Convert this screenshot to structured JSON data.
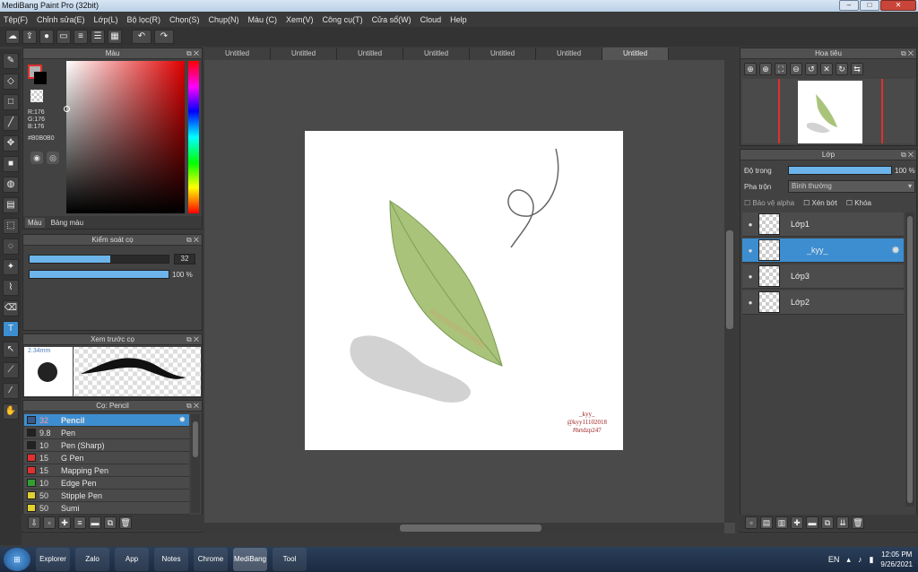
{
  "window": {
    "title": "MediBang Paint Pro (32bit)",
    "minimize": "–",
    "maximize": "□",
    "close": "✕"
  },
  "menu": [
    "Tệp(F)",
    "Chỉnh sửa(E)",
    "Lớp(L)",
    "Bộ lọc(R)",
    "Chọn(S)",
    "Chụp(N)",
    "Màu (C)",
    "Xem(V)",
    "Công cụ(T)",
    "Cửa sổ(W)",
    "Cloud",
    "Help"
  ],
  "toolbar_icons": [
    "cloud-icon",
    "upload-icon",
    "chat-icon",
    "comment-icon",
    "doc-icon",
    "list-icon",
    "grid-icon"
  ],
  "undo_label": "↶",
  "redo_label": "↷",
  "color_panel": {
    "title": "Màu",
    "r": "R:176",
    "g": "G:176",
    "b": "B:176",
    "hex": "#B0B0B0",
    "tab_color": "Màu",
    "tab_palette": "Bảng màu",
    "primary_color": "#b0b0b0"
  },
  "brush_control": {
    "title": "Kiểm soát cọ",
    "size": "32",
    "size_fraction": 0.6,
    "opacity": "100 %",
    "opacity_fraction": 1.0
  },
  "brush_preview": {
    "title": "Xem trước cọ",
    "size_label": "2.34mm"
  },
  "brush_list": {
    "title": "Cọ: Pencil",
    "items": [
      {
        "size": "32",
        "name": "Pencil",
        "color": "#3a5a88",
        "selected": true
      },
      {
        "size": "9.8",
        "name": "Pen",
        "color": "#222222",
        "selected": false
      },
      {
        "size": "10",
        "name": "Pen (Sharp)",
        "color": "#222222",
        "selected": false
      },
      {
        "size": "15",
        "name": "G Pen",
        "color": "#e03030",
        "selected": false
      },
      {
        "size": "15",
        "name": "Mapping Pen",
        "color": "#e03030",
        "selected": false
      },
      {
        "size": "10",
        "name": "Edge Pen",
        "color": "#30a030",
        "selected": false
      },
      {
        "size": "50",
        "name": "Stipple Pen",
        "color": "#e0d030",
        "selected": false
      },
      {
        "size": "50",
        "name": "Sumi",
        "color": "#e0d030",
        "selected": false
      }
    ]
  },
  "document_tabs": [
    "Untitled",
    "Untitled",
    "Untitled",
    "Untitled",
    "Untitled",
    "Untitled",
    "Untitled"
  ],
  "canvas": {
    "signature_line1": "_kyy_",
    "signature_line2": "@kyy11102018",
    "signature_line3": "#hrtdzp247"
  },
  "navigator": {
    "title": "Hoa tiêu"
  },
  "layers": {
    "title": "Lớp",
    "opacity_label": "Độ trong",
    "opacity_value": "100 %",
    "opacity_fraction": 1.0,
    "blend_label": "Pha trộn",
    "blend_value": "Bình thường",
    "protect_alpha": "Bảo vệ alpha",
    "clipping": "Xén bớt",
    "lock": "Khóa",
    "items": [
      {
        "name": "Lớp1",
        "selected": false
      },
      {
        "name": "_kyy_",
        "selected": true
      },
      {
        "name": "Lớp3",
        "selected": false
      },
      {
        "name": "Lớp2",
        "selected": false
      }
    ]
  },
  "taskbar": {
    "lang": "EN",
    "time": "12:05 PM",
    "date": "9/26/2021",
    "apps": [
      "Explorer",
      "Zalo",
      "App",
      "Notes",
      "Chrome",
      "MediBang",
      "Tool"
    ]
  }
}
